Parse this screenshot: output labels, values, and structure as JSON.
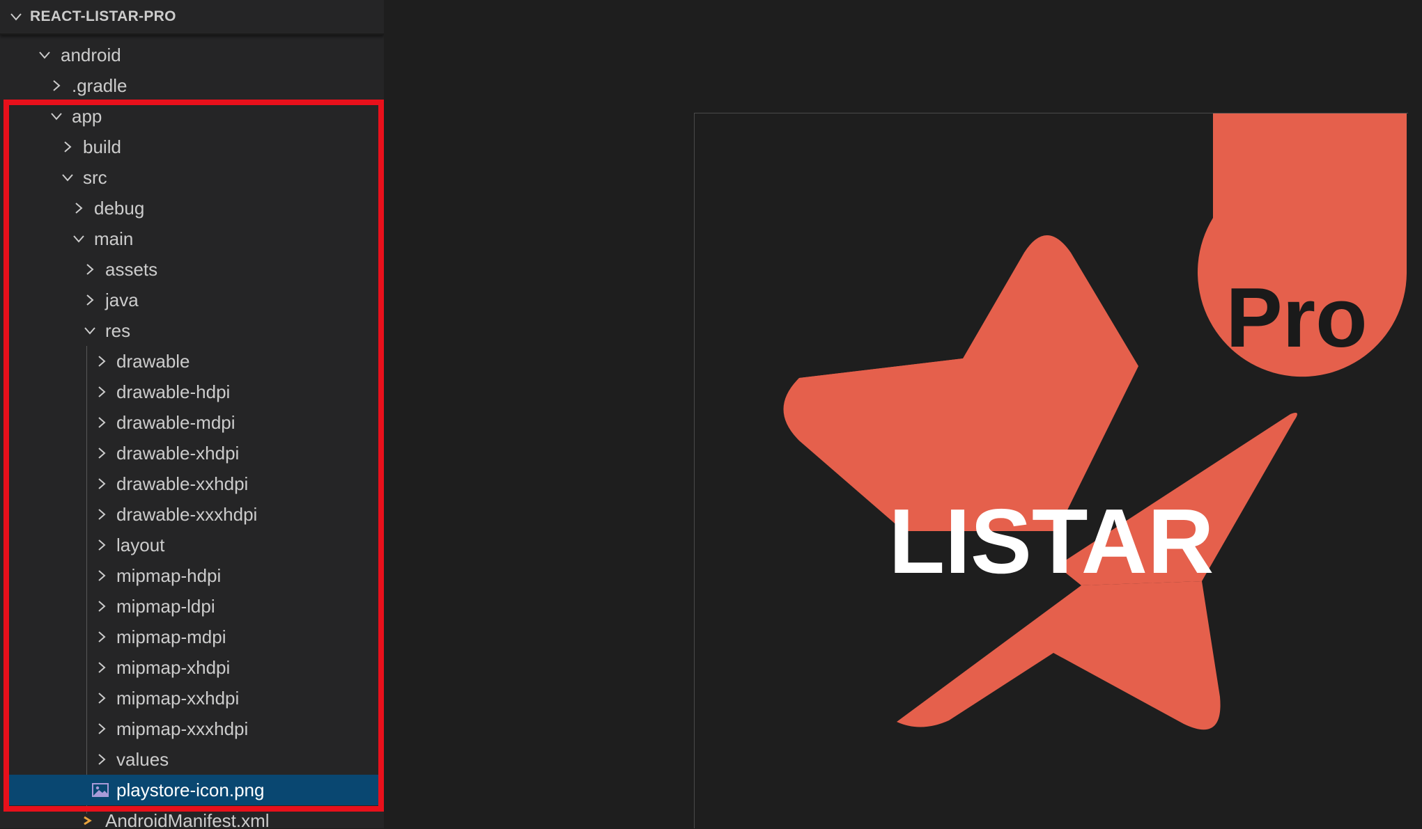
{
  "explorer": {
    "section_title": "REACT-LISTAR-PRO",
    "items": [
      {
        "label": "android",
        "type": "folder",
        "expanded": true
      },
      {
        "label": ".gradle",
        "type": "folder",
        "expanded": false
      },
      {
        "label": "app",
        "type": "folder",
        "expanded": true
      },
      {
        "label": "build",
        "type": "folder",
        "expanded": false
      },
      {
        "label": "src",
        "type": "folder",
        "expanded": true
      },
      {
        "label": "debug",
        "type": "folder",
        "expanded": false
      },
      {
        "label": "main",
        "type": "folder",
        "expanded": true
      },
      {
        "label": "assets",
        "type": "folder",
        "expanded": false
      },
      {
        "label": "java",
        "type": "folder",
        "expanded": false
      },
      {
        "label": "res",
        "type": "folder",
        "expanded": true
      },
      {
        "label": "drawable",
        "type": "folder",
        "expanded": false
      },
      {
        "label": "drawable-hdpi",
        "type": "folder",
        "expanded": false
      },
      {
        "label": "drawable-mdpi",
        "type": "folder",
        "expanded": false
      },
      {
        "label": "drawable-xhdpi",
        "type": "folder",
        "expanded": false
      },
      {
        "label": "drawable-xxhdpi",
        "type": "folder",
        "expanded": false
      },
      {
        "label": "drawable-xxxhdpi",
        "type": "folder",
        "expanded": false
      },
      {
        "label": "layout",
        "type": "folder",
        "expanded": false
      },
      {
        "label": "mipmap-hdpi",
        "type": "folder",
        "expanded": false
      },
      {
        "label": "mipmap-ldpi",
        "type": "folder",
        "expanded": false
      },
      {
        "label": "mipmap-mdpi",
        "type": "folder",
        "expanded": false
      },
      {
        "label": "mipmap-xhdpi",
        "type": "folder",
        "expanded": false
      },
      {
        "label": "mipmap-xxhdpi",
        "type": "folder",
        "expanded": false
      },
      {
        "label": "mipmap-xxxhdpi",
        "type": "folder",
        "expanded": false
      },
      {
        "label": "values",
        "type": "folder",
        "expanded": false
      },
      {
        "label": "playstore-icon.png",
        "type": "image-file",
        "selected": true
      },
      {
        "label": "AndroidManifest.xml",
        "type": "xml-file"
      }
    ]
  },
  "preview": {
    "logo_text": "LISTAR",
    "badge_text": "Pro"
  },
  "colors": {
    "sidebar_bg": "#252526",
    "editor_bg": "#1e1e1e",
    "selection_bg": "#094771",
    "highlight_border": "#e8101b",
    "logo_accent": "#e5604c",
    "logo_text": "#ffffff",
    "badge_text": "#1a1a1a"
  }
}
